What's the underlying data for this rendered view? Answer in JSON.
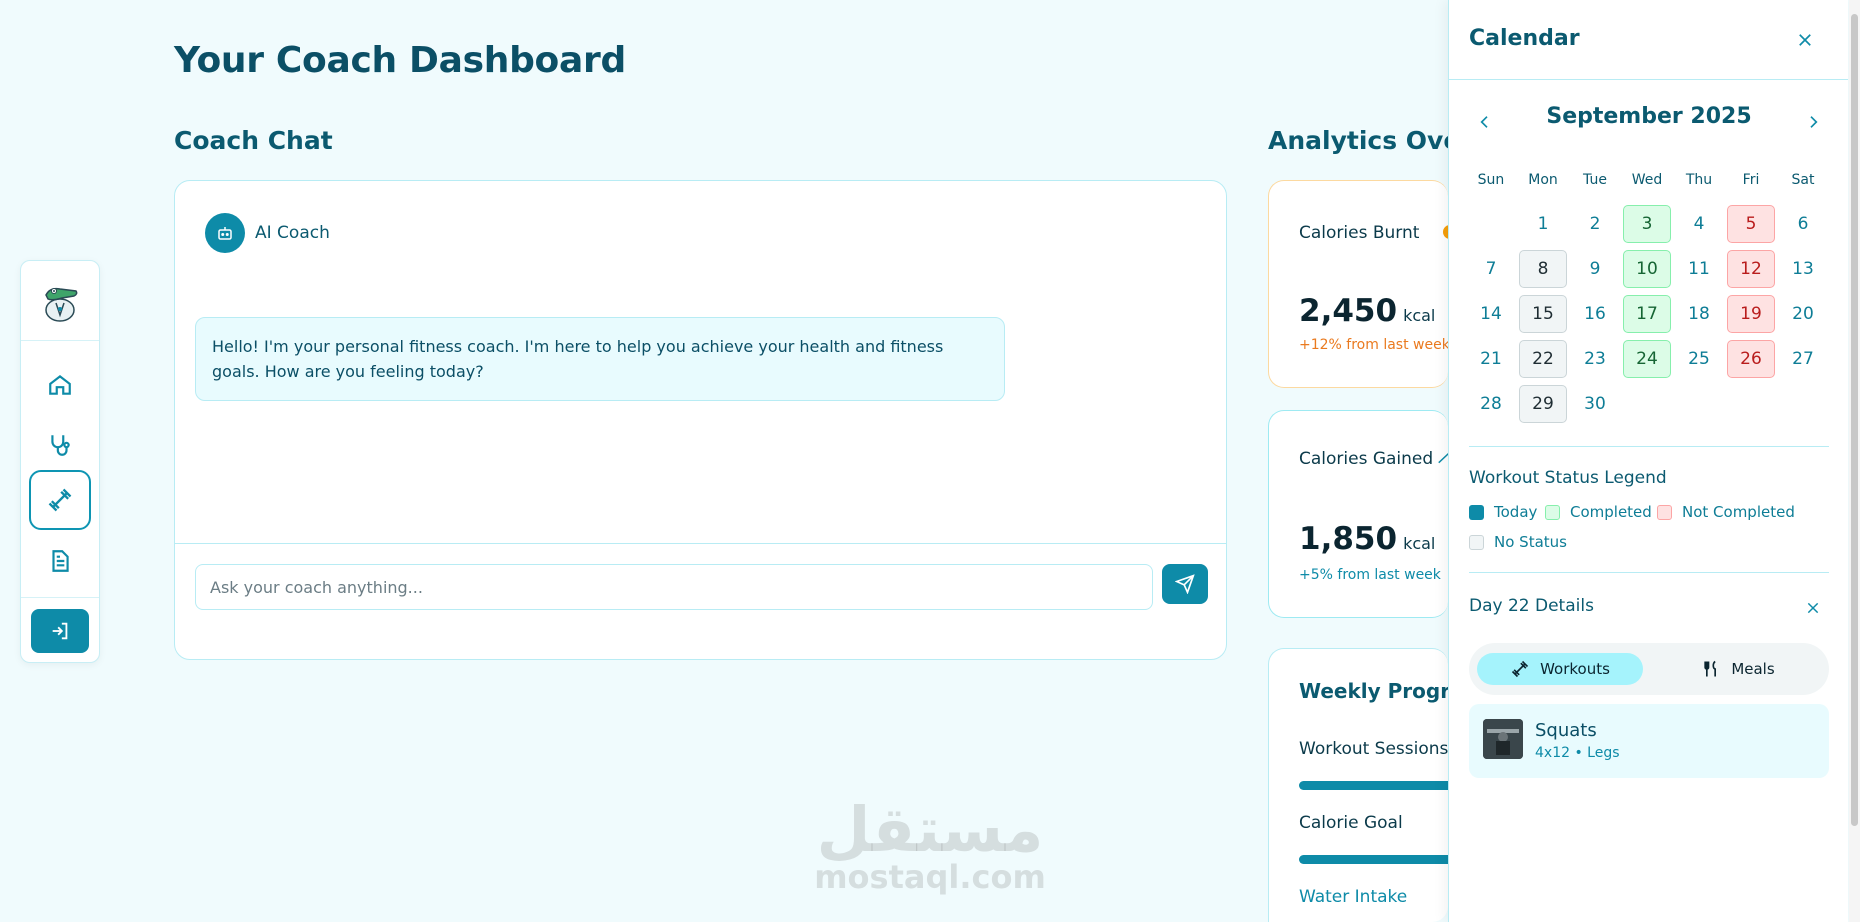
{
  "page": {
    "title": "Your Coach Dashboard"
  },
  "sidebar": {
    "items": [
      {
        "name": "home",
        "icon": "home-icon"
      },
      {
        "name": "health",
        "icon": "stethoscope-icon"
      },
      {
        "name": "workouts",
        "icon": "dumbbell-icon",
        "active": true
      },
      {
        "name": "plans",
        "icon": "document-icon"
      }
    ],
    "login_icon": "login-icon"
  },
  "chat": {
    "section_title": "Coach Chat",
    "coach_name": "AI Coach",
    "messages": [
      {
        "from": "coach",
        "text": "Hello! I'm your personal fitness coach. I'm here to help you achieve your health and fitness goals. How are you feeling today?"
      }
    ],
    "input_placeholder": "Ask your coach anything..."
  },
  "analytics": {
    "section_title": "Analytics Overview",
    "calories_burnt": {
      "label": "Calories Burnt",
      "value": "2,450",
      "unit": "kcal",
      "delta": "+12% from last week",
      "color": "#f59e0b"
    },
    "calories_gained": {
      "label": "Calories Gained",
      "value": "1,850",
      "unit": "kcal",
      "delta": "+5% from last week",
      "color": "#14b8a6"
    },
    "weekly": {
      "title": "Weekly Progress",
      "items": [
        {
          "label": "Workout Sessions"
        },
        {
          "label": "Calorie Goal"
        },
        {
          "label": "Water Intake"
        }
      ]
    }
  },
  "calendar": {
    "title": "Calendar",
    "month_label": "September 2025",
    "weekdays": [
      "Sun",
      "Mon",
      "Tue",
      "Wed",
      "Thu",
      "Fri",
      "Sat"
    ],
    "first_weekday_index": 1,
    "days": [
      {
        "d": "1",
        "s": ""
      },
      {
        "d": "2",
        "s": ""
      },
      {
        "d": "3",
        "s": "completed"
      },
      {
        "d": "4",
        "s": ""
      },
      {
        "d": "5",
        "s": "notcompleted"
      },
      {
        "d": "6",
        "s": ""
      },
      {
        "d": "7",
        "s": ""
      },
      {
        "d": "8",
        "s": "nostatus"
      },
      {
        "d": "9",
        "s": ""
      },
      {
        "d": "10",
        "s": "completed"
      },
      {
        "d": "11",
        "s": ""
      },
      {
        "d": "12",
        "s": "notcompleted"
      },
      {
        "d": "13",
        "s": ""
      },
      {
        "d": "14",
        "s": ""
      },
      {
        "d": "15",
        "s": "nostatus"
      },
      {
        "d": "16",
        "s": ""
      },
      {
        "d": "17",
        "s": "completed"
      },
      {
        "d": "18",
        "s": ""
      },
      {
        "d": "19",
        "s": "notcompleted"
      },
      {
        "d": "20",
        "s": ""
      },
      {
        "d": "21",
        "s": ""
      },
      {
        "d": "22",
        "s": "nostatus"
      },
      {
        "d": "23",
        "s": ""
      },
      {
        "d": "24",
        "s": "completed"
      },
      {
        "d": "25",
        "s": ""
      },
      {
        "d": "26",
        "s": "notcompleted"
      },
      {
        "d": "27",
        "s": ""
      },
      {
        "d": "28",
        "s": ""
      },
      {
        "d": "29",
        "s": "nostatus"
      },
      {
        "d": "30",
        "s": ""
      }
    ],
    "legend": {
      "title": "Workout Status Legend",
      "items": [
        {
          "label": "Today",
          "color": "#0e8ba8"
        },
        {
          "label": "Completed",
          "color": "#dcfce7"
        },
        {
          "label": "Not Completed",
          "color": "#fee2e2"
        },
        {
          "label": "No Status",
          "color": "#f1f5f6"
        }
      ]
    },
    "details": {
      "title": "Day 22 Details",
      "tabs": [
        {
          "label": "Workouts",
          "active": true
        },
        {
          "label": "Meals",
          "active": false
        }
      ],
      "workouts": [
        {
          "name": "Squats",
          "meta": "4x12 • Legs"
        }
      ]
    }
  },
  "watermark": {
    "arabic": "مستقل",
    "latin": "mostaql.com"
  }
}
